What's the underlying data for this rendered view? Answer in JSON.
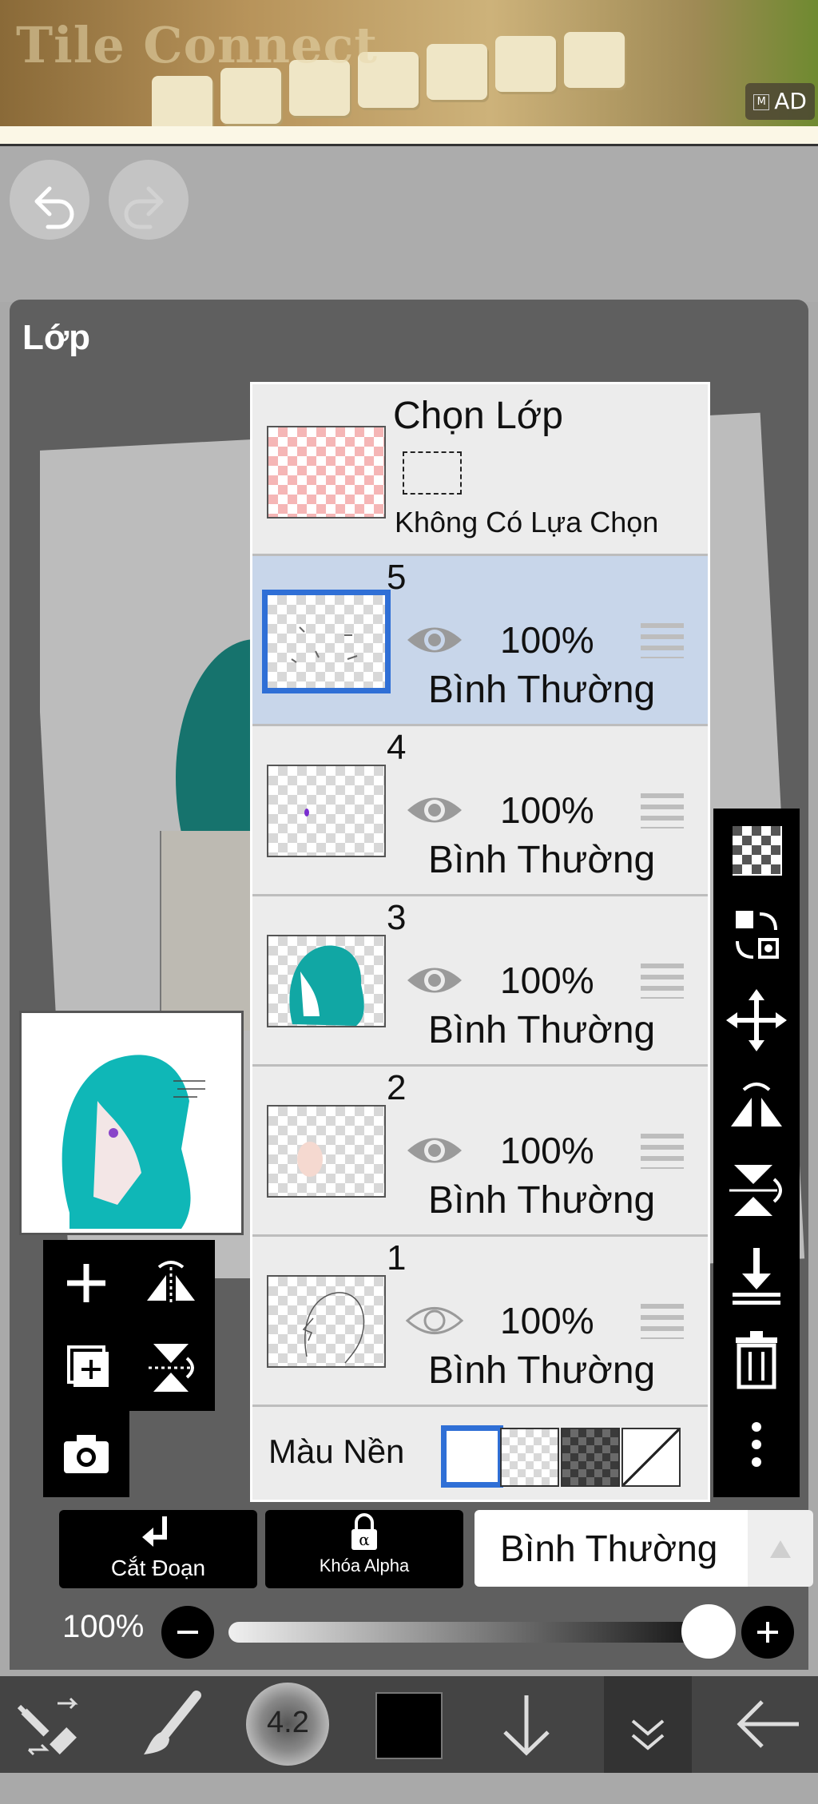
{
  "ad": {
    "title": "Tile Connect",
    "badge_icon": "M",
    "badge_label": "AD"
  },
  "header": {
    "undo_icon": "undo-icon",
    "redo_icon": "redo-icon"
  },
  "panel": {
    "title": "Lớp",
    "selection": {
      "title": "Chọn Lớp",
      "subtitle": "Không Có Lựa Chọn"
    },
    "layers": [
      {
        "number": "5",
        "opacity": "100%",
        "blend": "Bình Thường",
        "visible": true,
        "selected": true
      },
      {
        "number": "4",
        "opacity": "100%",
        "blend": "Bình Thường",
        "visible": true,
        "selected": false
      },
      {
        "number": "3",
        "opacity": "100%",
        "blend": "Bình Thường",
        "visible": true,
        "selected": false
      },
      {
        "number": "2",
        "opacity": "100%",
        "blend": "Bình Thường",
        "visible": true,
        "selected": false
      },
      {
        "number": "1",
        "opacity": "100%",
        "blend": "Bình Thường",
        "visible": false,
        "selected": false
      }
    ],
    "background_label": "Màu Nền"
  },
  "controls": {
    "clip_label": "Cắt Đoạn",
    "alpha_lock_label": "Khóa Alpha",
    "blend_mode": "Bình Thường",
    "opacity_label": "100%",
    "opacity_value": 1.0
  },
  "toolbar": {
    "brush_size": "4.2"
  },
  "colors": {
    "accent": "#2f6fd6",
    "selected_row": "#c8d6ea",
    "hair": "#16736d"
  }
}
